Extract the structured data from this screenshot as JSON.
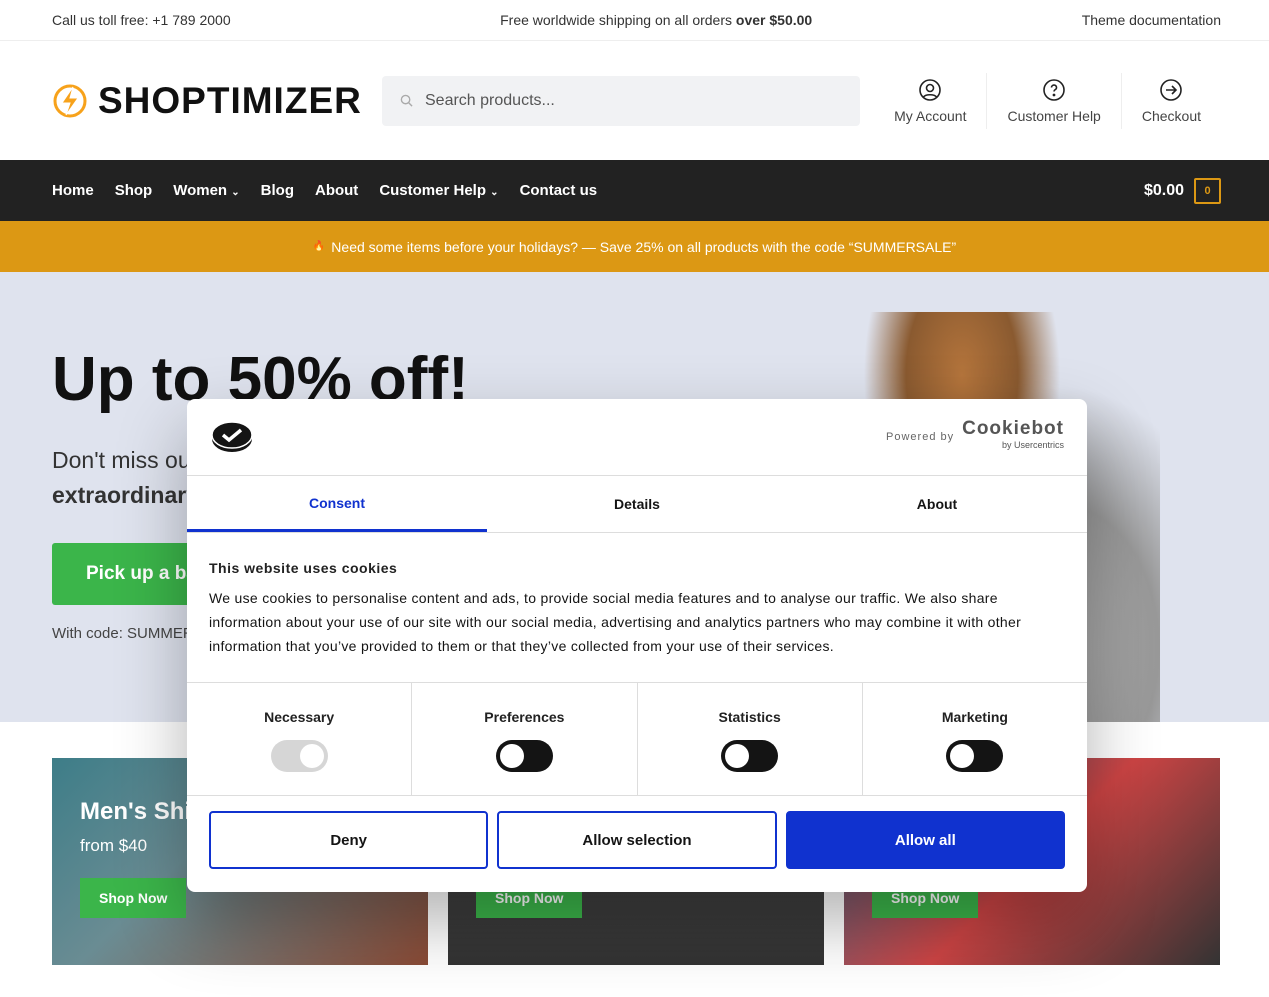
{
  "topbar": {
    "phone": "Call us toll free: +1 789 2000",
    "shipping": "Free worldwide shipping on all orders ",
    "shipping_bold": "over $50.00",
    "docs": "Theme documentation"
  },
  "header": {
    "logo": "SHOPTIMIZER",
    "search_placeholder": "Search products...",
    "icons": [
      {
        "label": "My Account",
        "icon": "user-circle-icon"
      },
      {
        "label": "Customer Help",
        "icon": "question-circle-icon"
      },
      {
        "label": "Checkout",
        "icon": "arrow-circle-icon"
      }
    ]
  },
  "nav": {
    "items": [
      "Home",
      "Shop",
      "Women",
      "Blog",
      "About",
      "Customer Help",
      "Contact us"
    ],
    "cart_total": "$0.00",
    "cart_count": "0"
  },
  "promo": {
    "text": "Need some items before your holidays? — Save 25% on all products with the code “SUMMERSALE”"
  },
  "hero": {
    "title": "Up to 50% off!",
    "line1": "Don't miss our",
    "line2": "extraordinary",
    "cta": "Pick up a bargain",
    "code": "With code: SUMMER"
  },
  "cards": [
    {
      "title": "Men's Shirts",
      "from": "from $40",
      "cta": "Shop Now"
    },
    {
      "cta": "Shop Now"
    },
    {
      "cta": "Shop Now"
    }
  ],
  "cookie": {
    "powered": "Powered by",
    "brand": "Cookiebot",
    "brand_sub": "by Usercentrics",
    "tabs": [
      "Consent",
      "Details",
      "About"
    ],
    "heading": "This website uses cookies",
    "body": "We use cookies to personalise content and ads, to provide social media features and to analyse our traffic. We also share information about your use of our site with our social media, advertising and analytics partners who may combine it with other information that you’ve provided to them or that they’ve collected from your use of their services.",
    "toggles": [
      {
        "label": "Necessary",
        "on": true,
        "disabled": true
      },
      {
        "label": "Preferences",
        "on": false
      },
      {
        "label": "Statistics",
        "on": false
      },
      {
        "label": "Marketing",
        "on": false
      }
    ],
    "deny": "Deny",
    "allow_selection": "Allow selection",
    "allow_all": "Allow all"
  },
  "colors": {
    "accent": "#dc9814",
    "cookie_blue": "#1032cf",
    "green": "#3bb54a"
  }
}
